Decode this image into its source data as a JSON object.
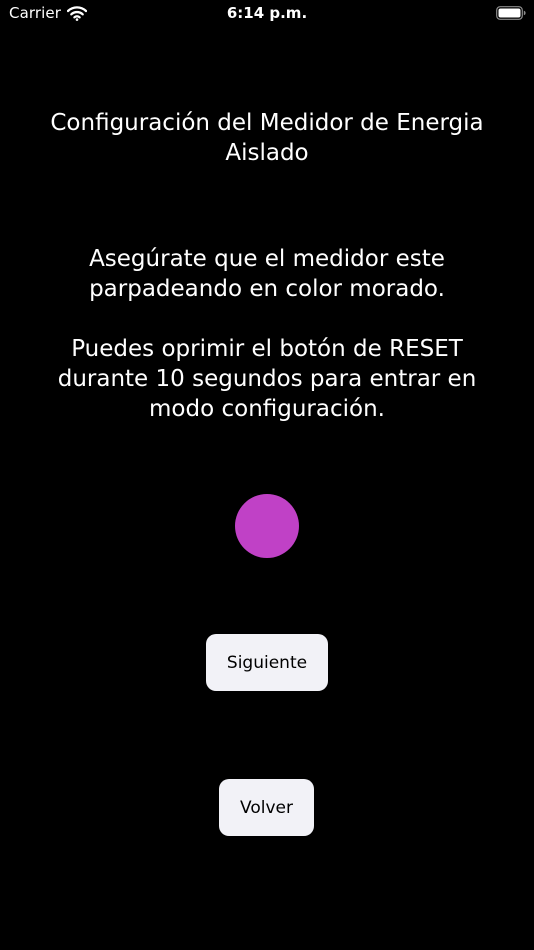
{
  "status_bar": {
    "carrier": "Carrier",
    "time": "6:14 p.m.",
    "wifi_icon": "wifi-icon",
    "battery_icon": "battery-full-icon"
  },
  "screen": {
    "title": "Configuración del Medidor de Energia Aislado",
    "instruction_1": "Asegúrate que el medidor este parpadeando en color morado.",
    "instruction_2": "Puedes oprimir el botón de RESET durante 10 segundos para entrar en modo configuración.",
    "indicator_color": "#c041c6",
    "next_label": "Siguiente",
    "back_label": "Volver"
  },
  "colors": {
    "background": "#000000",
    "text": "#ffffff",
    "button_background": "#f2f2f7",
    "button_text": "#000000"
  }
}
